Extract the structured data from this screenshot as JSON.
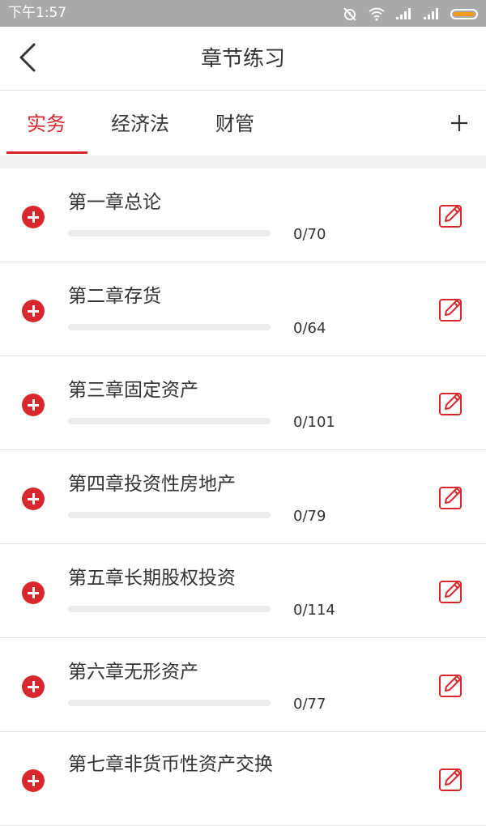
{
  "status_bar": {
    "time": "下午1:57",
    "icons": [
      "alarm-off-icon",
      "wifi-icon",
      "signal-icon",
      "signal-icon",
      "battery-icon"
    ]
  },
  "header": {
    "title": "章节练习",
    "back_icon": "chevron-left-icon"
  },
  "tabs": {
    "items": [
      {
        "label": "实务",
        "active": true
      },
      {
        "label": "经济法",
        "active": false
      },
      {
        "label": "财管",
        "active": false
      }
    ],
    "add_icon": "plus-icon"
  },
  "colors": {
    "accent": "#d8282d",
    "status_bar": "#aaaaaa",
    "battery": "#f39a16"
  },
  "chapters": [
    {
      "title": "第一章总论",
      "done": 0,
      "total": 70,
      "count": "0/70"
    },
    {
      "title": "第二章存货",
      "done": 0,
      "total": 64,
      "count": "0/64"
    },
    {
      "title": "第三章固定资产",
      "done": 0,
      "total": 101,
      "count": "0/101"
    },
    {
      "title": "第四章投资性房地产",
      "done": 0,
      "total": 79,
      "count": "0/79"
    },
    {
      "title": "第五章长期股权投资",
      "done": 0,
      "total": 114,
      "count": "0/114"
    },
    {
      "title": "第六章无形资产",
      "done": 0,
      "total": 77,
      "count": "0/77"
    },
    {
      "title": "第七章非货币性资产交换",
      "done": null,
      "total": null,
      "count": ""
    }
  ]
}
